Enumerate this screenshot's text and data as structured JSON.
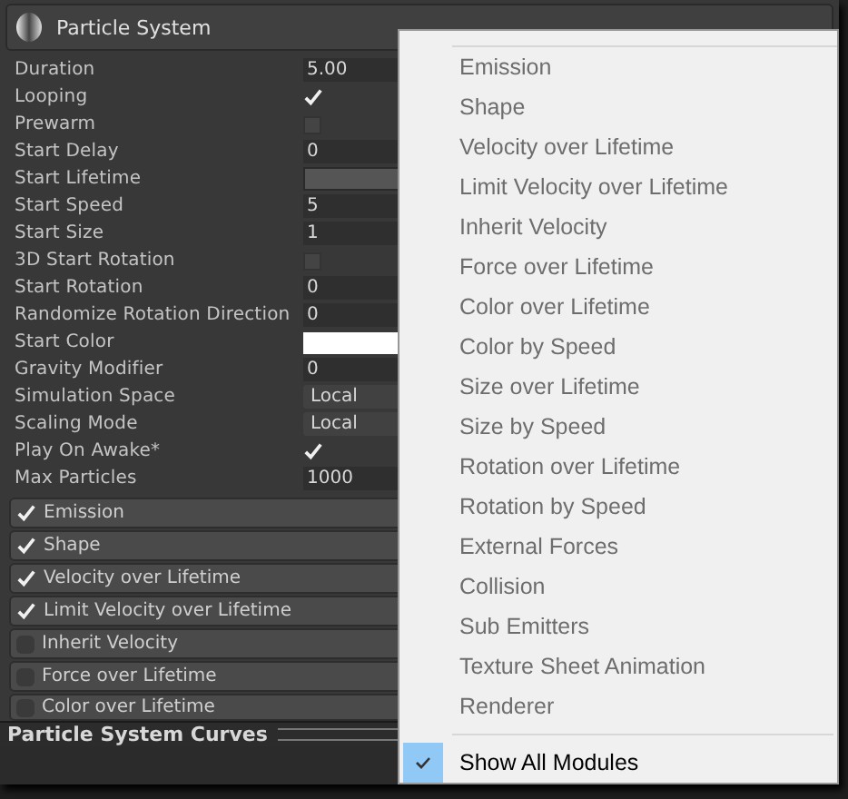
{
  "inspector": {
    "title": "Particle System",
    "properties": [
      {
        "label": "Duration",
        "kind": "number",
        "value": "5.00"
      },
      {
        "label": "Looping",
        "kind": "checkbox",
        "checked": true
      },
      {
        "label": "Prewarm",
        "kind": "checkbox",
        "checked": false
      },
      {
        "label": "Start Delay",
        "kind": "number",
        "value": "0"
      },
      {
        "label": "Start Lifetime",
        "kind": "curve"
      },
      {
        "label": "Start Speed",
        "kind": "number",
        "value": "5"
      },
      {
        "label": "Start Size",
        "kind": "number",
        "value": "1"
      },
      {
        "label": "3D Start Rotation",
        "kind": "checkbox",
        "checked": false
      },
      {
        "label": "Start Rotation",
        "kind": "number",
        "value": "0"
      },
      {
        "label": "Randomize Rotation Direction",
        "kind": "number",
        "value": "0"
      },
      {
        "label": "Start Color",
        "kind": "color"
      },
      {
        "label": "Gravity Modifier",
        "kind": "number",
        "value": "0"
      },
      {
        "label": "Simulation Space",
        "kind": "dropdown",
        "value": "Local"
      },
      {
        "label": "Scaling Mode",
        "kind": "dropdown",
        "value": "Local"
      },
      {
        "label": "Play On Awake*",
        "kind": "checkbox",
        "checked": true
      },
      {
        "label": "Max Particles",
        "kind": "number",
        "value": "1000"
      }
    ],
    "modules": [
      {
        "label": "Emission",
        "enabled": true
      },
      {
        "label": "Shape",
        "enabled": true
      },
      {
        "label": "Velocity over Lifetime",
        "enabled": true
      },
      {
        "label": "Limit Velocity over Lifetime",
        "enabled": true
      },
      {
        "label": "Inherit Velocity",
        "enabled": false
      },
      {
        "label": "Force over Lifetime",
        "enabled": false
      },
      {
        "label": "Color over Lifetime",
        "enabled": false
      }
    ]
  },
  "curves_panel": {
    "title": "Particle System Curves"
  },
  "context_menu": {
    "items": [
      {
        "label": "Emission",
        "disabled": true,
        "checked": false
      },
      {
        "label": "Shape",
        "disabled": true,
        "checked": false
      },
      {
        "label": "Velocity over Lifetime",
        "disabled": true,
        "checked": false
      },
      {
        "label": "Limit Velocity over Lifetime",
        "disabled": true,
        "checked": false
      },
      {
        "label": "Inherit Velocity",
        "disabled": true,
        "checked": false
      },
      {
        "label": "Force over Lifetime",
        "disabled": true,
        "checked": false
      },
      {
        "label": "Color over Lifetime",
        "disabled": true,
        "checked": false
      },
      {
        "label": "Color by Speed",
        "disabled": true,
        "checked": false
      },
      {
        "label": "Size over Lifetime",
        "disabled": true,
        "checked": false
      },
      {
        "label": "Size by Speed",
        "disabled": true,
        "checked": false
      },
      {
        "label": "Rotation over Lifetime",
        "disabled": true,
        "checked": false
      },
      {
        "label": "Rotation by Speed",
        "disabled": true,
        "checked": false
      },
      {
        "label": "External Forces",
        "disabled": true,
        "checked": false
      },
      {
        "label": "Collision",
        "disabled": true,
        "checked": false
      },
      {
        "label": "Sub Emitters",
        "disabled": true,
        "checked": false
      },
      {
        "label": "Texture Sheet Animation",
        "disabled": true,
        "checked": false
      },
      {
        "label": "Renderer",
        "disabled": true,
        "checked": false
      },
      {
        "kind": "separator"
      },
      {
        "label": "Show All Modules",
        "disabled": false,
        "checked": true
      }
    ]
  }
}
